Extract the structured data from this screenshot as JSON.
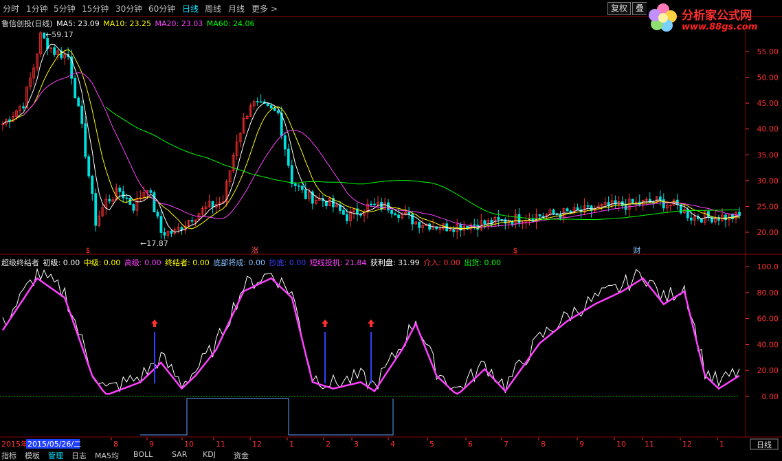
{
  "toolbar": {
    "periods": [
      "分时",
      "1分钟",
      "5分钟",
      "15分钟",
      "30分钟",
      "60分钟",
      "日线",
      "周线",
      "月线",
      "更多 >"
    ],
    "active_period": "日线",
    "fuquan_label": "复权",
    "die_label": "叠"
  },
  "logo": {
    "title": "分析家公式网",
    "url": "www.88gs.com"
  },
  "main_chart": {
    "stock_name": "鲁信创投(日线)",
    "ma5_label": "MA5: 23.09",
    "ma10_label": "MA10: 23.25",
    "ma20_label": "MA20: 23.03",
    "ma60_label": "MA60: 24.06",
    "high_label": "59.17",
    "low_label": "17.87",
    "y_ticks": [
      "55.00",
      "50.00",
      "45.00",
      "40.00",
      "35.00",
      "30.00",
      "25.00",
      "20.00"
    ],
    "markers": [
      {
        "text": "$",
        "color": "#ff3030"
      },
      {
        "text": "涨",
        "color": "#ff5050"
      },
      {
        "text": "$",
        "color": "#ff3030"
      },
      {
        "text": "财",
        "color": "#80c0ff"
      }
    ],
    "colors": {
      "up": "#ff3030",
      "down": "#00e0e0",
      "ma5": "#ffffff",
      "ma10": "#ffff00",
      "ma20": "#ff40ff",
      "ma60": "#00ff00"
    }
  },
  "indicator": {
    "name": "超级终结者",
    "items": [
      {
        "label": "初级: 0.00",
        "color": "#ffffff"
      },
      {
        "label": "中级: 0.00",
        "color": "#ffff00"
      },
      {
        "label": "高级: 0.00",
        "color": "#ff40ff"
      },
      {
        "label": "终结者: 0.00",
        "color": "#ffff00"
      },
      {
        "label": "底部将成: 0.00",
        "color": "#80c0ff"
      },
      {
        "label": "抄底: 0.00",
        "color": "#4040ff"
      },
      {
        "label": "短线投机: 21.84",
        "color": "#ff40ff"
      },
      {
        "label": "获利盘: 31.99",
        "color": "#ffffff"
      },
      {
        "label": "介入: 0.00",
        "color": "#ff3030"
      },
      {
        "label": "出货: 0.00",
        "color": "#00ff00"
      }
    ],
    "y_ticks": [
      "100.0",
      "80.00",
      "60.00",
      "40.00",
      "20.00",
      "0.00"
    ]
  },
  "time_axis": {
    "start_year": "2015年",
    "cursor_date": "2015/05/26/二",
    "months": [
      "8",
      "9",
      "10",
      "11",
      "12",
      "1",
      "2",
      "3",
      "4",
      "5",
      "6",
      "7",
      "8",
      "9",
      "10",
      "11",
      "12",
      "1"
    ],
    "period_label": "日线"
  },
  "bottom_tabs": [
    "指标",
    "模板",
    "管理",
    "日志",
    "MA5均",
    "BOLL",
    "SAR",
    "KDJ",
    "资金"
  ]
}
